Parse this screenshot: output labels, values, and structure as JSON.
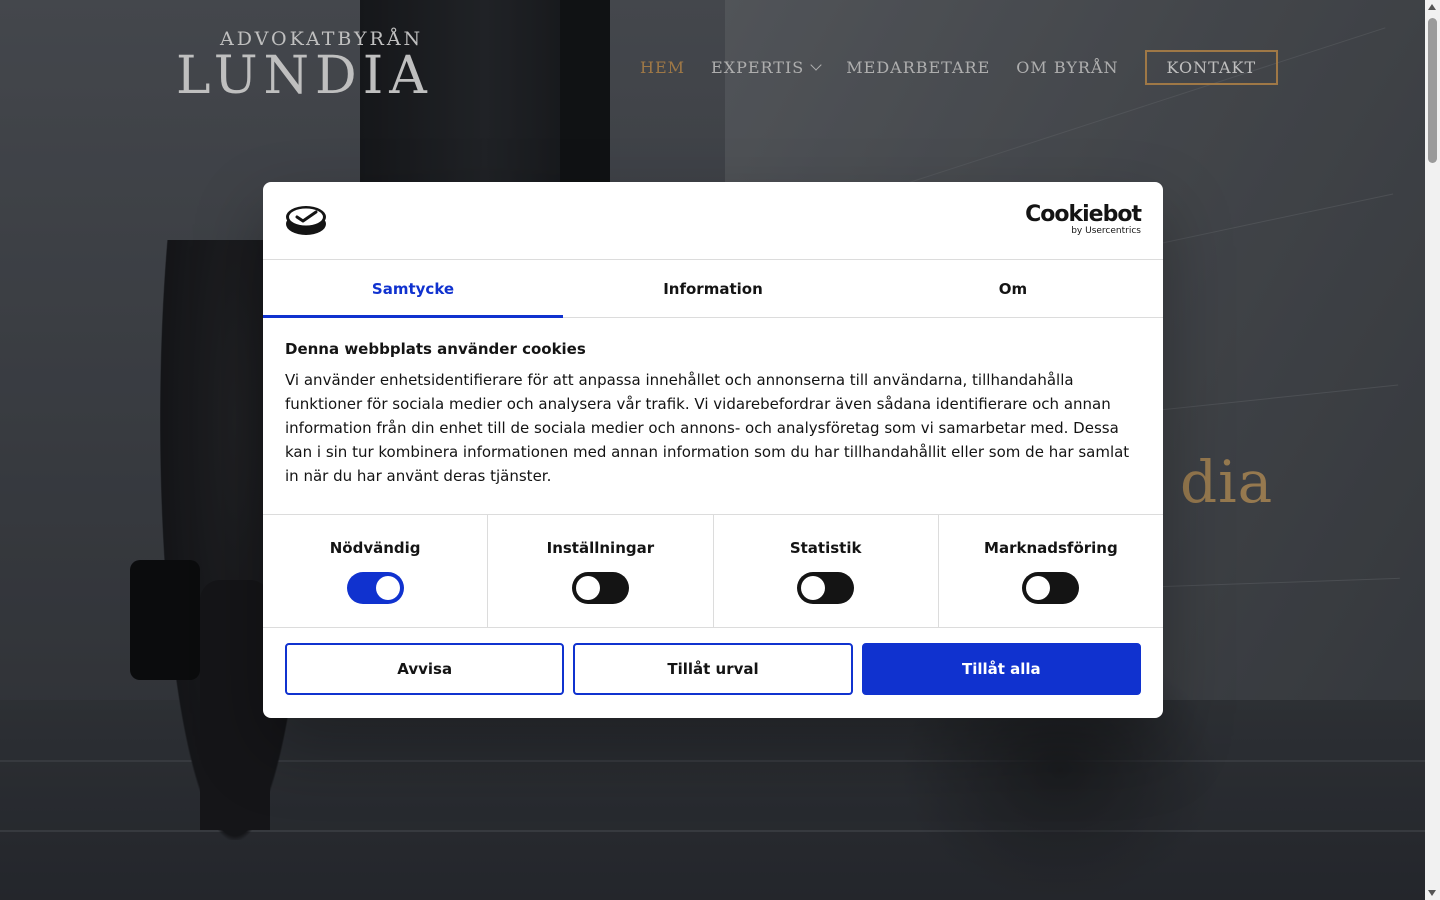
{
  "site": {
    "logo_sub": "ADVOKATBYRÅN",
    "logo_main": "LUNDIA",
    "hero_title_fragment": "dia"
  },
  "nav": {
    "items": [
      {
        "label": "HEM",
        "active": true
      },
      {
        "label": "EXPERTIS",
        "has_dropdown": true
      },
      {
        "label": "MEDARBETARE"
      },
      {
        "label": "OM BYRÅN"
      }
    ],
    "cta": "KONTAKT"
  },
  "colors": {
    "accent_gold": "#d4a15e",
    "cookiebot_blue": "#1032cf"
  },
  "cookie_dialog": {
    "brand": "Cookiebot",
    "brand_sub": "by Usercentrics",
    "tabs": [
      {
        "label": "Samtycke",
        "active": true
      },
      {
        "label": "Information"
      },
      {
        "label": "Om"
      }
    ],
    "heading": "Denna webbplats använder cookies",
    "body": "Vi använder enhetsidentifierare för att anpassa innehållet och annonserna till användarna, tillhandahålla funktioner för sociala medier och analysera vår trafik. Vi vidarebefordrar även sådana identifierare och annan information från din enhet till de sociala medier och annons- och analysföretag som vi samarbetar med. Dessa kan i sin tur kombinera informationen med annan information som du har tillhandahållit eller som de har samlat in när du har använt deras tjänster.",
    "categories": [
      {
        "label": "Nödvändig",
        "enabled": true
      },
      {
        "label": "Inställningar",
        "enabled": false
      },
      {
        "label": "Statistik",
        "enabled": false
      },
      {
        "label": "Marknadsföring",
        "enabled": false
      }
    ],
    "buttons": {
      "deny": "Avvisa",
      "allow_selection": "Tillåt urval",
      "allow_all": "Tillåt alla"
    }
  }
}
